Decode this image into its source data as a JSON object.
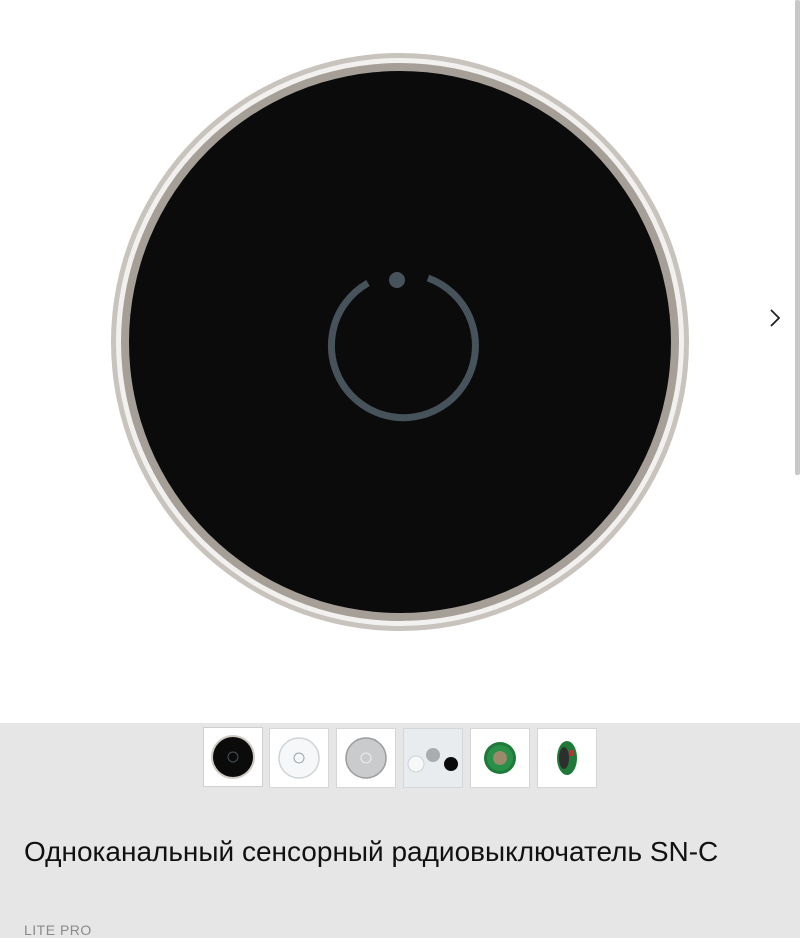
{
  "product": {
    "title": "Одноканальный сенсорный радиовыключатель SN-C",
    "brand": "LITE PRO"
  },
  "gallery": {
    "next_icon": "chevron-right-icon",
    "thumbnails": [
      {
        "label": "black switch",
        "variant": "black",
        "active": true
      },
      {
        "label": "white switch",
        "variant": "white"
      },
      {
        "label": "grey switch",
        "variant": "grey"
      },
      {
        "label": "switch parts",
        "variant": "parts"
      },
      {
        "label": "circuit board back",
        "variant": "board"
      },
      {
        "label": "circuit board side",
        "variant": "board-side"
      }
    ]
  },
  "colors": {
    "panel": "#0b0b0b",
    "ring": "#b9b4ad",
    "power_symbol": "#47535a",
    "thumb_bar": "#e6e6e6",
    "board_green": "#1f7a3a"
  }
}
